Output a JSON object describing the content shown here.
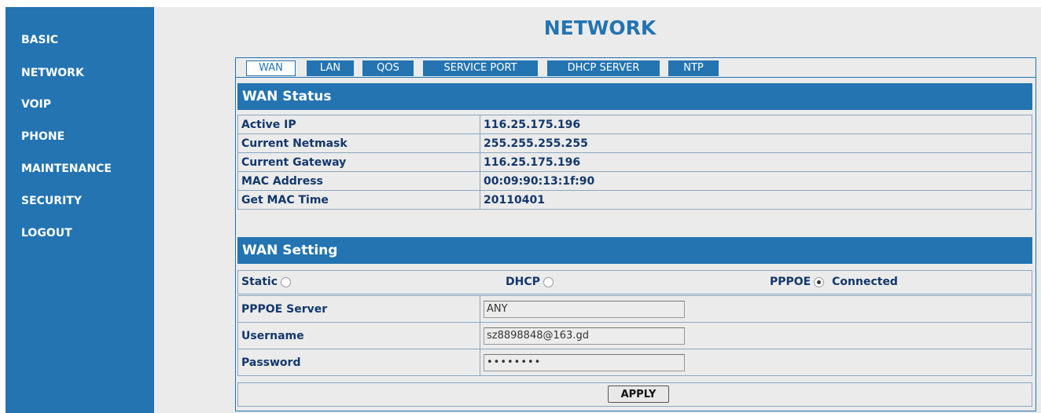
{
  "sidebar": {
    "items": [
      {
        "label": "BASIC"
      },
      {
        "label": "NETWORK"
      },
      {
        "label": "VOIP"
      },
      {
        "label": "PHONE"
      },
      {
        "label": "MAINTENANCE"
      },
      {
        "label": "SECURITY"
      },
      {
        "label": "LOGOUT"
      }
    ]
  },
  "page": {
    "title": "NETWORK"
  },
  "tabs": [
    {
      "label": "WAN",
      "active": true
    },
    {
      "label": "LAN"
    },
    {
      "label": "QOS"
    },
    {
      "label": "SERVICE PORT"
    },
    {
      "label": "DHCP SERVER"
    },
    {
      "label": "NTP"
    }
  ],
  "wan_status": {
    "title": "WAN Status",
    "rows": [
      {
        "label": "Active IP",
        "value": "116.25.175.196"
      },
      {
        "label": "Current Netmask",
        "value": "255.255.255.255"
      },
      {
        "label": "Current Gateway",
        "value": "116.25.175.196"
      },
      {
        "label": "MAC Address",
        "value": "00:09:90:13:1f:90"
      },
      {
        "label": "Get MAC Time",
        "value": "20110401"
      }
    ]
  },
  "wan_setting": {
    "title": "WAN Setting",
    "modes": {
      "static": "Static",
      "dhcp": "DHCP",
      "pppoe": "PPPOE",
      "pppoe_status": "Connected",
      "selected": "PPPOE"
    },
    "fields": {
      "server_label": "PPPOE Server",
      "server_value": "ANY",
      "username_label": "Username",
      "username_value": "sz8898848@163.gd",
      "password_label": "Password",
      "password_value": "••••••••"
    },
    "apply_label": "APPLY"
  },
  "colors": {
    "accent": "#2374b1",
    "text": "#13386b",
    "background": "#ebebeb"
  }
}
